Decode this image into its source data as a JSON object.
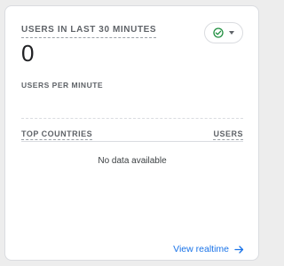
{
  "card": {
    "metric_label": "Users in last 30 minutes",
    "metric_value": "0",
    "status": {
      "icon": "check-circle-icon",
      "dropdown_icon": "caret-down-icon",
      "color": "#1e8e3e"
    },
    "section_label": "Users per minute",
    "table": {
      "columns": [
        "Top countries",
        "Users"
      ],
      "empty_message": "No data available"
    },
    "footer": {
      "link_label": "View realtime",
      "icon": "arrow-right-icon",
      "color": "#1a73e8"
    }
  }
}
